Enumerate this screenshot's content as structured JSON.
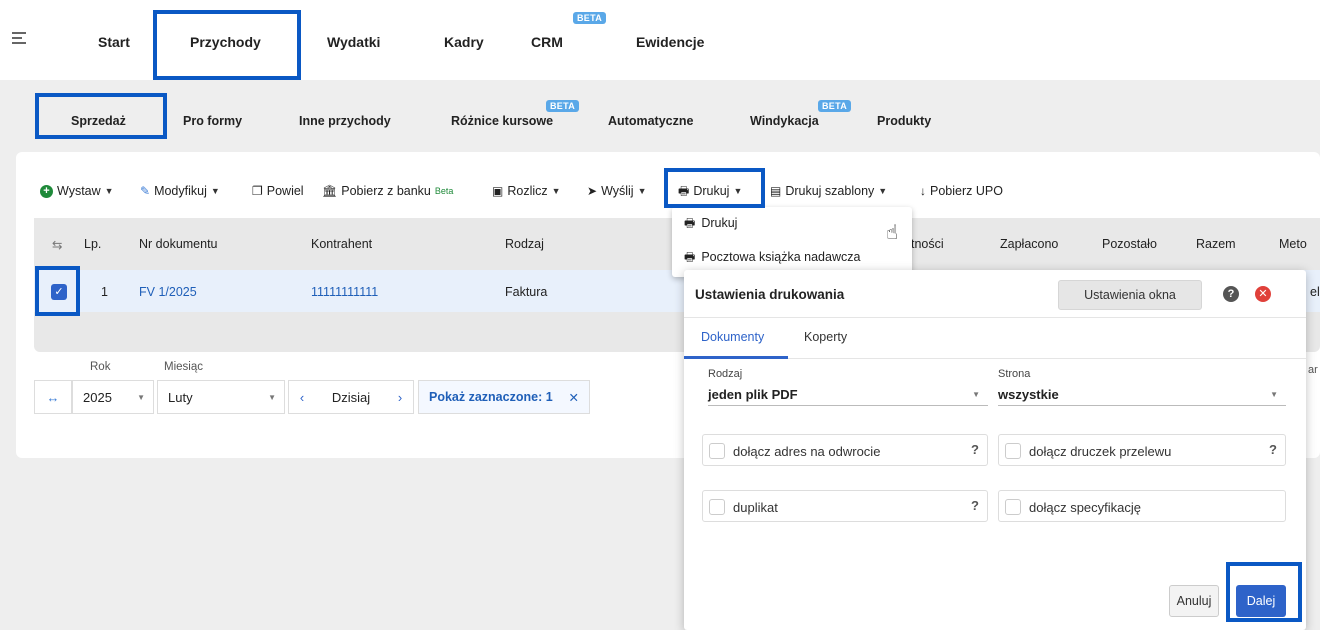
{
  "topnav": {
    "tabs": [
      "Start",
      "Przychody",
      "Wydatki",
      "Kadry",
      "CRM",
      "Ewidencje"
    ],
    "beta": "BETA"
  },
  "subnav": {
    "tabs": [
      "Sprzedaż",
      "Pro formy",
      "Inne przychody",
      "Różnice kursowe",
      "Automatyczne",
      "Windykacja",
      "Produkty"
    ]
  },
  "toolbar": {
    "wystaw": "Wystaw",
    "modyfikuj": "Modyfikuj",
    "powiel": "Powiel",
    "pobierz_z_banku": "Pobierz z banku",
    "beta_small": "Beta",
    "rozlicz": "Rozlicz",
    "wyslij": "Wyślij",
    "drukuj": "Drukuj",
    "drukuj_szablony": "Drukuj szablony",
    "pobierz_upo": "Pobierz UPO"
  },
  "table": {
    "headers": [
      "Lp.",
      "Nr dokumentu",
      "Kontrahent",
      "Rodzaj",
      "tności",
      "Zapłacono",
      "Pozostało",
      "Razem",
      "Meto"
    ],
    "row": {
      "lp": "1",
      "nr": "FV 1/2025",
      "kontrahent": "11111111111",
      "rodzaj": "Faktura",
      "extra": "el"
    }
  },
  "filters": {
    "rok_label": "Rok",
    "rok_value": "2025",
    "miesiac_label": "Miesiąc",
    "miesiac_value": "Luty",
    "today": "Dzisiaj",
    "selected": "Pokaż zaznaczone: 1",
    "edge": "ar"
  },
  "dropdown": {
    "items": [
      "Drukuj",
      "Pocztowa książka nadawcza"
    ]
  },
  "modal": {
    "title": "Ustawienia drukowania",
    "window_settings": "Ustawienia okna",
    "tabs": [
      "Dokumenty",
      "Koperty"
    ],
    "rodzaj_label": "Rodzaj",
    "rodzaj_value": "jeden plik PDF",
    "strona_label": "Strona",
    "strona_value": "wszystkie",
    "options": [
      "dołącz adres na odwrocie",
      "dołącz druczek przelewu",
      "duplikat",
      "dołącz specyfikację"
    ],
    "cancel": "Anuluj",
    "next": "Dalej"
  }
}
